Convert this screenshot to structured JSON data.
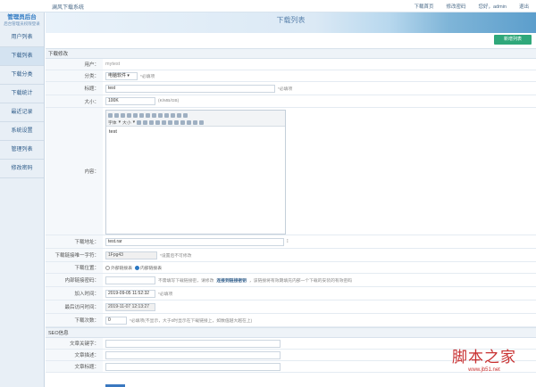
{
  "window": {
    "system_name": "澜风下载系统"
  },
  "top_nav": [
    "下载首页",
    "修改密码",
    "您好，admin",
    "退出"
  ],
  "logo": {
    "title": "管理员后台",
    "subtitle": "后台管理员权限登录"
  },
  "sidebar": {
    "items": [
      {
        "label": "用户列表",
        "active": false
      },
      {
        "label": "下载列表",
        "active": true
      },
      {
        "label": "下载分类",
        "active": false
      },
      {
        "label": "下载统计",
        "active": false
      },
      {
        "label": "最近记录",
        "active": false
      },
      {
        "label": "系统设置",
        "active": false
      },
      {
        "label": "管理列表",
        "active": false
      },
      {
        "label": "修改密码",
        "active": false
      }
    ]
  },
  "page_title": "下载列表",
  "add_button": "新增列表",
  "section_edit": "下载修改",
  "form": {
    "user": {
      "label": "用户：",
      "value": "mytest"
    },
    "category": {
      "label": "分类：",
      "value": "电脑软件",
      "hint": "*必填项"
    },
    "title": {
      "label": "标题：",
      "value": "test",
      "hint": "*必填项"
    },
    "size": {
      "label": "大小：",
      "value": "100K",
      "hint": "(K/MB/GB)"
    },
    "content": {
      "label": "内容：",
      "value": "test"
    },
    "download_url": {
      "label": "下载地址：",
      "value": "test.rar"
    },
    "unique": {
      "label": "下载链接唯一字符：",
      "value": "1Fpg43",
      "hint": "*设置后不可修改"
    },
    "location": {
      "label": "下载位置：",
      "opt1": "外部链接表",
      "opt2": "内部链接表"
    },
    "pwd": {
      "label": "内部链接密码：",
      "hint_a": "不需填写下载链接密，请修改",
      "hint_b": "连接到链接密钥",
      "hint_c": "，该链接将有效期填充内部一个下载的安装的有效密码"
    },
    "add_time": {
      "label": "加入时间：",
      "value": "2019-09-05 11:52:32",
      "hint": "*必填项"
    },
    "last_time": {
      "label": "最后访问时间：",
      "value": "2019-11-07 12:13:27"
    },
    "dl_count": {
      "label": "下载次数：",
      "value": "0",
      "hint": "*必填项(不显示，大于0时显示在下载链接上，如数值越大越在上)"
    }
  },
  "section_seo": "SEO信息",
  "seo": {
    "keywords": {
      "label": "文章关键字："
    },
    "description": {
      "label": "文章描述："
    },
    "title": {
      "label": "文章标题："
    }
  },
  "editor_toolbar": {
    "font": "字体",
    "size": "大小"
  },
  "watermark": {
    "line1": "脚本之家",
    "line2": "www.jb51.net"
  }
}
